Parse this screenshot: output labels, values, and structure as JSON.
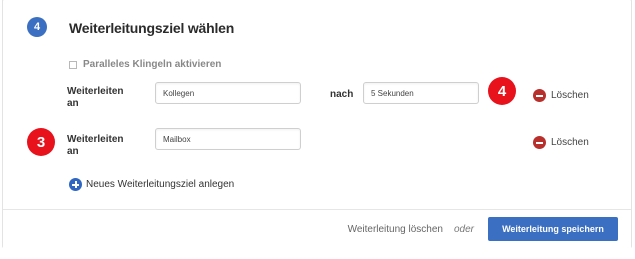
{
  "section": {
    "step_number": "4",
    "title": "Weiterleitungsziel wählen"
  },
  "parallel_ring": {
    "label": "Paralleles Klingeln aktivieren",
    "checked": false
  },
  "forward_rows": [
    {
      "label": "Weiterleiten an",
      "target": "Kollegen",
      "after_label": "nach",
      "delay": "5 Sekunden",
      "delete_label": "Löschen"
    },
    {
      "label": "Weiterleiten an",
      "target": "Mailbox",
      "delete_label": "Löschen"
    }
  ],
  "markers": {
    "row2_marker": "3",
    "delay_marker": "4"
  },
  "add_target": {
    "label": "Neues Weiterleitungsziel anlegen"
  },
  "footer": {
    "delete_label": "Weiterleitung löschen",
    "separator": "oder",
    "save_label": "Weiterleitung speichern"
  },
  "colors": {
    "primary": "#3b6fc2",
    "delete": "#b7302c",
    "marker": "#e8121c"
  },
  "icons": {
    "delete": "minus-circle-icon",
    "add": "plus-circle-icon"
  }
}
